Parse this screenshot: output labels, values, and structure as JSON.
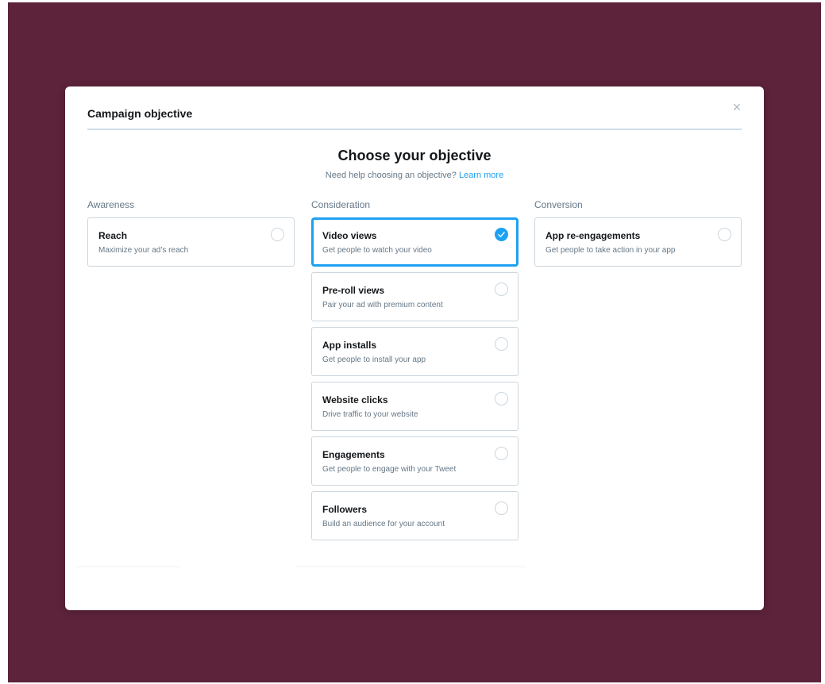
{
  "modal": {
    "title": "Campaign objective",
    "close_glyph": "×",
    "headline": "Choose your objective",
    "help_text": "Need help choosing an objective?",
    "help_link": "Learn more"
  },
  "columns": {
    "awareness": {
      "label": "Awareness",
      "cards": [
        {
          "title": "Reach",
          "description": "Maximize your ad’s reach",
          "selected": false
        }
      ]
    },
    "consideration": {
      "label": "Consideration",
      "cards": [
        {
          "title": "Video views",
          "description": "Get people to watch your video",
          "selected": true
        },
        {
          "title": "Pre-roll views",
          "description": "Pair your ad with premium content",
          "selected": false
        },
        {
          "title": "App installs",
          "description": "Get people to install your app",
          "selected": false
        },
        {
          "title": "Website clicks",
          "description": "Drive traffic to your website",
          "selected": false
        },
        {
          "title": "Engagements",
          "description": "Get people to engage with your Tweet",
          "selected": false
        },
        {
          "title": "Followers",
          "description": "Build an audience for your account",
          "selected": false
        }
      ]
    },
    "conversion": {
      "label": "Conversion",
      "cards": [
        {
          "title": "App re-engagements",
          "description": "Get people to take action in your app",
          "selected": false
        }
      ]
    }
  },
  "icons": {
    "close": "close-icon",
    "selected": "checkmark-icon",
    "unselected": "radio-empty-icon"
  },
  "colors": {
    "backdrop": "#5c233b",
    "accent": "#1da1f2",
    "border": "#ccd6dd",
    "muted_text": "#657786"
  }
}
